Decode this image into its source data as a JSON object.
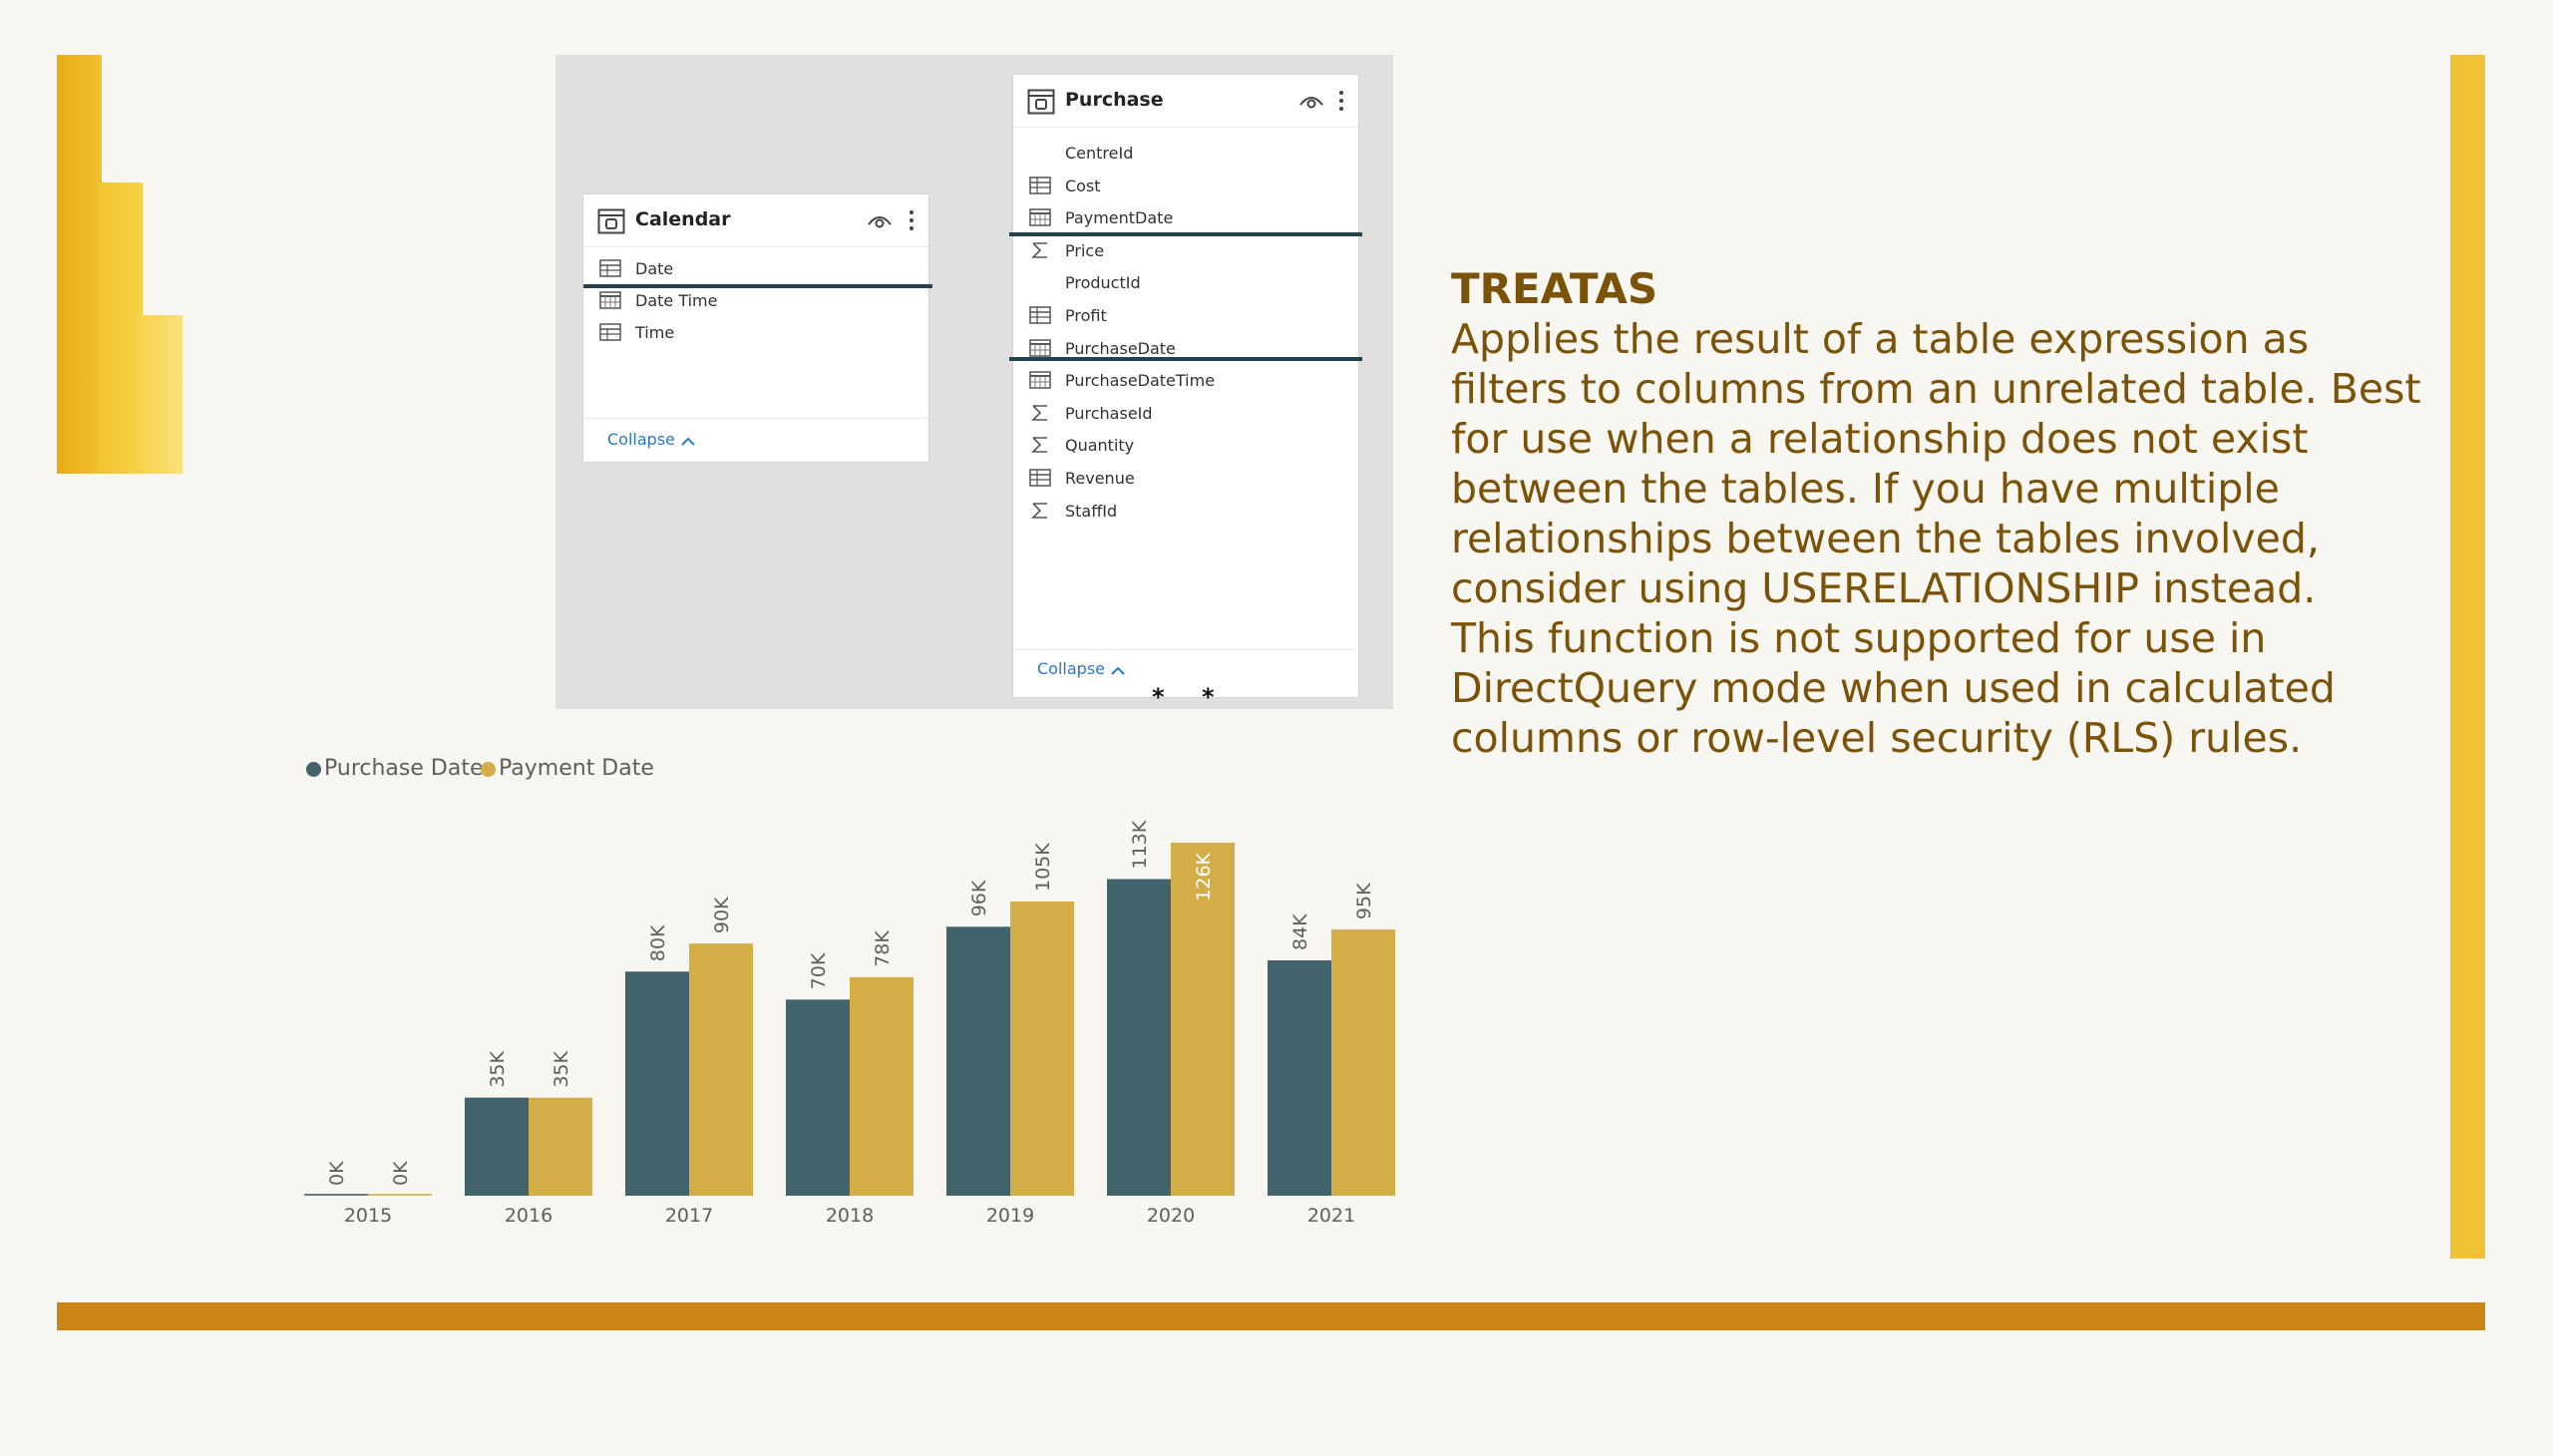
{
  "model": {
    "calendar": {
      "title": "Calendar",
      "fields": [
        {
          "label": "Date",
          "icon": "date-hierarchy-icon"
        },
        {
          "label": "Date Time",
          "icon": "calendar-icon"
        },
        {
          "label": "Time",
          "icon": "date-hierarchy-icon"
        }
      ],
      "collapse": "Collapse"
    },
    "purchase": {
      "title": "Purchase",
      "fields": [
        {
          "label": "CentreId",
          "icon": "none"
        },
        {
          "label": "Cost",
          "icon": "measure-table-icon"
        },
        {
          "label": "PaymentDate",
          "icon": "calendar-icon"
        },
        {
          "label": "Price",
          "icon": "sigma-icon"
        },
        {
          "label": "ProductId",
          "icon": "none"
        },
        {
          "label": "Profit",
          "icon": "measure-table-icon"
        },
        {
          "label": "PurchaseDate",
          "icon": "calendar-icon"
        },
        {
          "label": "PurchaseDateTime",
          "icon": "calendar-icon"
        },
        {
          "label": "PurchaseId",
          "icon": "sigma-icon"
        },
        {
          "label": "Quantity",
          "icon": "sigma-icon"
        },
        {
          "label": "Revenue",
          "icon": "measure-table-icon"
        },
        {
          "label": "StaffId",
          "icon": "sigma-icon"
        }
      ],
      "collapse": "Collapse"
    },
    "cardinality": [
      "*",
      "*"
    ]
  },
  "chart_data": {
    "type": "bar",
    "categories": [
      "2015",
      "2016",
      "2017",
      "2018",
      "2019",
      "2020",
      "2021"
    ],
    "series": [
      {
        "name": "Purchase Date",
        "color": "#41636c",
        "values": [
          0,
          35,
          80,
          70,
          96,
          113,
          84
        ],
        "labels": [
          "0K",
          "35K",
          "80K",
          "70K",
          "96K",
          "113K",
          "84K"
        ]
      },
      {
        "name": "Payment Date",
        "color": "#d3ad46",
        "values": [
          0,
          35,
          90,
          78,
          105,
          126,
          95
        ],
        "labels": [
          "0K",
          "35K",
          "90K",
          "78K",
          "105K",
          "126K",
          "95K"
        ]
      }
    ],
    "ylim": [
      0,
      126
    ],
    "legend": "top-left",
    "grid": false
  },
  "info": {
    "title": "TREATAS",
    "paragraph1": "Applies the result of a table expression as filters to columns from an unrelated table. Best for use when a relationship does not exist between the tables. If you have multiple relationships between the tables involved, consider using USERELATIONSHIP instead.",
    "paragraph2": "This function is not supported for use in DirectQuery mode when used in calculated columns or row-level security (RLS) rules."
  },
  "colors": {
    "accent_gold": "#efc235",
    "accent_orange": "#cb8515",
    "text_brown": "#7a5309",
    "series_teal": "#41636c",
    "series_gold": "#d3ad46"
  }
}
